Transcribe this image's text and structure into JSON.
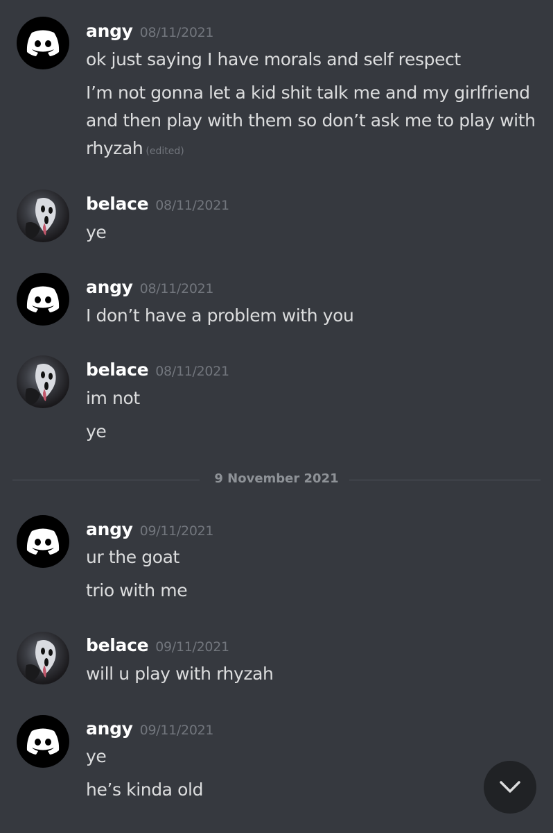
{
  "icons": {
    "avatar_angy": "discord-logo-icon",
    "avatar_belace": "ghostface-avatar",
    "scroll_button": "chevron-down-icon"
  },
  "colors": {
    "background": "#36393f",
    "username": "#ffffff",
    "timestamp": "#72767d",
    "text": "#dcddde"
  },
  "groups": [
    {
      "author": "angy",
      "timestamp": "08/11/2021",
      "messages": [
        "ok just saying I have morals and self respect",
        "I’m not gonna let a kid shit talk me and my girlfriend and then play with them so don’t ask me to play with rhyzah"
      ],
      "edited_label": "(edited)"
    },
    {
      "author": "belace",
      "timestamp": "08/11/2021",
      "messages": [
        "ye"
      ]
    },
    {
      "author": "angy",
      "timestamp": "08/11/2021",
      "messages": [
        "I don’t have a problem with you"
      ]
    },
    {
      "author": "belace",
      "timestamp": "08/11/2021",
      "messages": [
        "im not",
        "ye"
      ]
    },
    {
      "author": "angy",
      "timestamp": "09/11/2021",
      "messages": [
        "ur the goat",
        "trio with me"
      ]
    },
    {
      "author": "belace",
      "timestamp": "09/11/2021",
      "messages": [
        "will u play with rhyzah"
      ]
    },
    {
      "author": "angy",
      "timestamp": "09/11/2021",
      "messages": [
        "ye",
        "he’s kinda old"
      ]
    }
  ],
  "date_divider": "9 November 2021"
}
